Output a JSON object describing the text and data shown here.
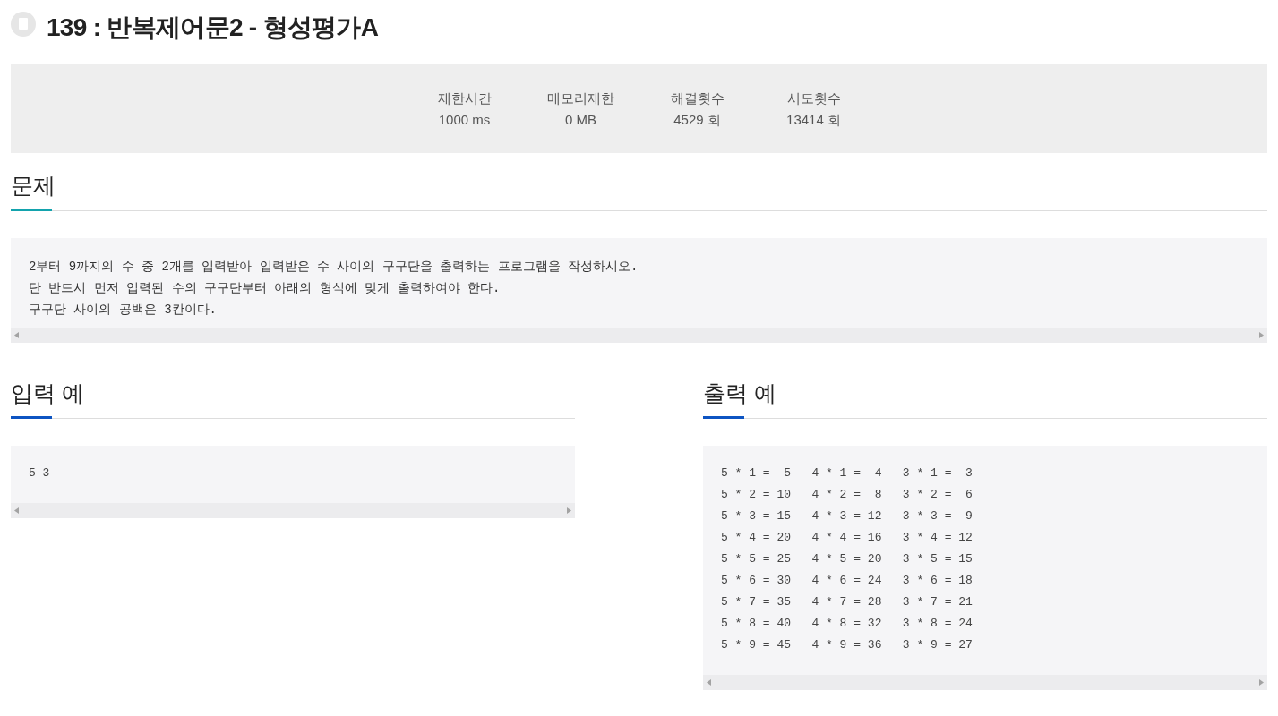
{
  "title": "139 : 반복제어문2 - 형성평가A",
  "stats": [
    {
      "label": "제한시간",
      "value": "1000 ms"
    },
    {
      "label": "메모리제한",
      "value": "0 MB"
    },
    {
      "label": "해결횟수",
      "value": "4529 회"
    },
    {
      "label": "시도횟수",
      "value": "13414 회"
    }
  ],
  "problem": {
    "heading": "문제",
    "lines": [
      "2부터 9까지의 수 중 2개를 입력받아 입력받은 수 사이의 구구단을 출력하는 프로그램을 작성하시오.",
      "단 반드시 먼저 입력된 수의 구구단부터 아래의 형식에 맞게 출력하여야 한다.",
      "구구단 사이의 공백은 3칸이다."
    ]
  },
  "sample_input": {
    "heading": "입력 예",
    "lines": [
      "5 3"
    ]
  },
  "sample_output": {
    "heading": "출력 예",
    "lines": [
      "5 * 1 =  5   4 * 1 =  4   3 * 1 =  3",
      "5 * 2 = 10   4 * 2 =  8   3 * 2 =  6",
      "5 * 3 = 15   4 * 3 = 12   3 * 3 =  9",
      "5 * 4 = 20   4 * 4 = 16   3 * 4 = 12",
      "5 * 5 = 25   4 * 5 = 20   3 * 5 = 15",
      "5 * 6 = 30   4 * 6 = 24   3 * 6 = 18",
      "5 * 7 = 35   4 * 7 = 28   3 * 7 = 21",
      "5 * 8 = 40   4 * 8 = 32   3 * 8 = 24",
      "5 * 9 = 45   4 * 9 = 36   3 * 9 = 27"
    ]
  }
}
